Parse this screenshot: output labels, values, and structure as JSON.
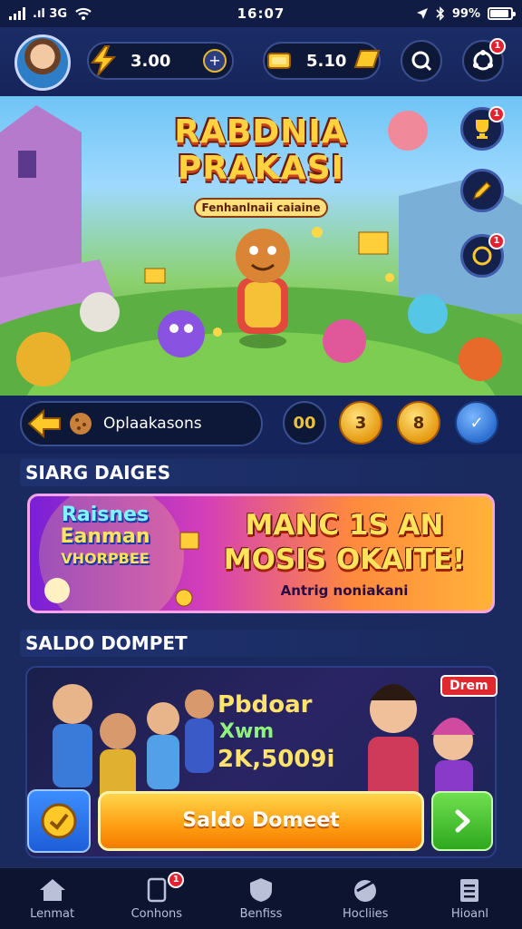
{
  "status_bar": {
    "carrier": ".ıl 3G",
    "time": "16:07",
    "battery": "99%"
  },
  "header": {
    "avatar_icon": "avatar-icon",
    "gems": {
      "value": "3.00",
      "icon": "lightning-gem-icon",
      "plus": "+"
    },
    "coins": {
      "value": "5.10",
      "icon": "gold-coin-icon"
    },
    "search_icon": "search-icon",
    "settings_badge": "1"
  },
  "hero": {
    "title_line1": "RABDNIA",
    "title_line2": "PRAKASI",
    "subtitle": "Fenhanlnaii caiaine",
    "side_buttons": [
      {
        "name": "side-button-trophy",
        "badge": "1"
      },
      {
        "name": "side-button-pencil"
      },
      {
        "name": "side-button-chat",
        "badge": "1"
      }
    ]
  },
  "options": {
    "label": "Oplaakasons",
    "buttons": [
      "00",
      "3",
      "8",
      "✓"
    ]
  },
  "sections": {
    "featured_title": "SIARG DAIGES",
    "wallet_title": "SALDO DOMPET"
  },
  "promo": {
    "logo_line1": "Raisnes",
    "logo_line2": "Eanman",
    "logo_line3": "VHORPBEE",
    "headline_line1": "MANC 1S AN",
    "headline_line2": "MOSIS OKAITE!",
    "subtext": "Antrig noniakani"
  },
  "wallet": {
    "line1": "Pbdoar",
    "line2": "Xwm",
    "amount": "2K,5009i",
    "tag": "Drem",
    "cta_label": "Saldo Domeet"
  },
  "bottom_nav": [
    {
      "label": "Lenmat",
      "icon": "home-icon"
    },
    {
      "label": "Conhons",
      "icon": "tablet-icon",
      "badge": "1"
    },
    {
      "label": "Benfiss",
      "icon": "shield-icon"
    },
    {
      "label": "Hocliies",
      "icon": "bird-icon"
    },
    {
      "label": "Hioanl",
      "icon": "list-icon"
    }
  ],
  "colors": {
    "background": "#1a2a5e",
    "accent_gold": "#ffd54a",
    "accent_green": "#2ea81e",
    "badge_red": "#e5202f"
  }
}
